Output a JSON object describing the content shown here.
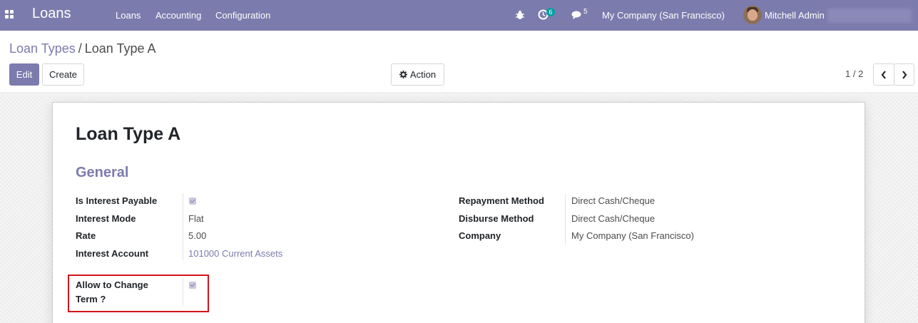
{
  "navbar": {
    "brand": "Loans",
    "menu": [
      "Loans",
      "Accounting",
      "Configuration"
    ],
    "activity_count": "6",
    "message_count": "5",
    "company": "My Company (San Francisco)",
    "user": "Mitchell Admin"
  },
  "breadcrumb": {
    "parent": "Loan Types",
    "separator": "/",
    "current": "Loan Type A"
  },
  "toolbar": {
    "edit": "Edit",
    "create": "Create",
    "action": "Action"
  },
  "pager": {
    "value": "1 / 2"
  },
  "record": {
    "name": "Loan Type A",
    "section": "General",
    "left_fields": [
      {
        "label": "Is Interest Payable",
        "type": "checkbox",
        "checked": true
      },
      {
        "label": "Interest Mode",
        "value": "Flat"
      },
      {
        "label": "Rate",
        "value": "5.00"
      },
      {
        "label": "Interest Account",
        "value": "101000 Current Assets"
      }
    ],
    "right_fields": [
      {
        "label": "Repayment Method",
        "value": "Direct Cash/Cheque"
      },
      {
        "label": "Disburse Method",
        "value": "Direct Cash/Cheque"
      },
      {
        "label": "Company",
        "value": "My Company (San Francisco)"
      }
    ],
    "allow_change_term": {
      "label_line1": "Allow to Change",
      "label_line2": "Term ?",
      "checked": true
    }
  },
  "colors": {
    "brand": "#7c7bad",
    "highlight": "#d0131b",
    "badge": "#00a09d"
  }
}
